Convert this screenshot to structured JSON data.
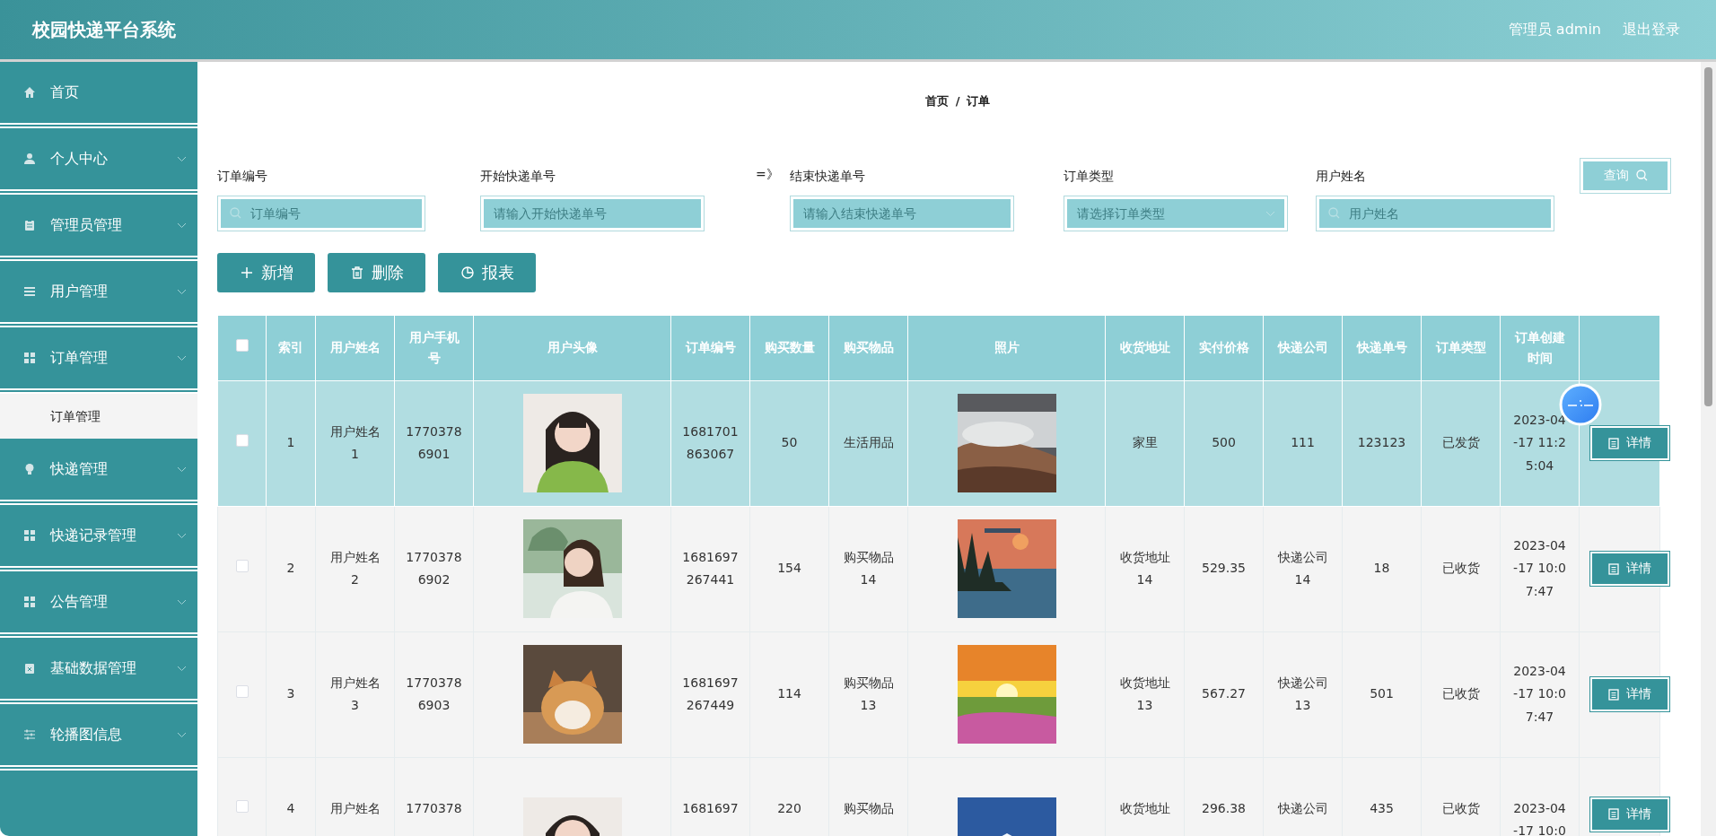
{
  "header": {
    "title": "校园快递平台系统",
    "user": "管理员 admin",
    "logout": "退出登录"
  },
  "sidebar": {
    "items": [
      {
        "label": "首页",
        "expandable": false
      },
      {
        "label": "个人中心",
        "expandable": true
      },
      {
        "label": "管理员管理",
        "expandable": true
      },
      {
        "label": "用户管理",
        "expandable": true
      },
      {
        "label": "订单管理",
        "expandable": true,
        "children": [
          {
            "label": "订单管理",
            "selected": true
          }
        ]
      },
      {
        "label": "快递管理",
        "expandable": true
      },
      {
        "label": "快递记录管理",
        "expandable": true
      },
      {
        "label": "公告管理",
        "expandable": true
      },
      {
        "label": "基础数据管理",
        "expandable": true
      },
      {
        "label": "轮播图信息",
        "expandable": true
      }
    ]
  },
  "breadcrumb": {
    "items": [
      "首页",
      "订单"
    ],
    "separator": "/"
  },
  "search": {
    "fields": [
      {
        "kind": "search",
        "label": "订单编号",
        "placeholder": "订单编号"
      },
      {
        "kind": "text",
        "label": "开始快递单号",
        "placeholder": "请输入开始快递单号"
      },
      {
        "kind": "text",
        "label": "结束快递单号",
        "placeholder": "请输入结束快递单号",
        "prefix": "=》"
      },
      {
        "kind": "select",
        "label": "订单类型",
        "placeholder": "请选择订单类型"
      },
      {
        "kind": "search",
        "label": "用户姓名",
        "placeholder": "用户姓名"
      }
    ],
    "button": "查询"
  },
  "actions": [
    "新增",
    "删除",
    "报表"
  ],
  "table": {
    "select_all": {
      "checked": false
    },
    "columns": [
      "索引",
      "用户姓名",
      "用户手机号",
      "用户头像",
      "订单编号",
      "购买数量",
      "购买物品",
      "照片",
      "收货地址",
      "实付价格",
      "快递公司",
      "快递单号",
      "订单类型",
      "订单创建时间"
    ],
    "rows": [
      {
        "selected": true,
        "checked": false,
        "cut": false,
        "cells": [
          "1",
          "用户姓名1",
          "17703786901",
          {
            "kind": "picture"
          },
          "1681701863067",
          "50",
          "生活用品",
          {
            "kind": "picture"
          },
          "家里",
          "500",
          "111",
          "123123",
          "已发货",
          "2023-04-17 11:25:04"
        ],
        "action": "详情"
      },
      {
        "selected": false,
        "checked": false,
        "cut": false,
        "cells": [
          "2",
          "用户姓名2",
          "17703786902",
          {
            "kind": "picture"
          },
          "1681697267441",
          "154",
          "购买物品14",
          {
            "kind": "picture"
          },
          "收货地址14",
          "529.35",
          "快递公司14",
          "18",
          "已收货",
          "2023-04-17 10:07:47"
        ],
        "action": "详情"
      },
      {
        "selected": false,
        "checked": false,
        "cut": false,
        "cells": [
          "3",
          "用户姓名3",
          "17703786903",
          {
            "kind": "picture"
          },
          "1681697267449",
          "114",
          "购买物品13",
          {
            "kind": "picture"
          },
          "收货地址13",
          "567.27",
          "快递公司13",
          "501",
          "已收货",
          "2023-04-17 10:07:47"
        ],
        "action": "详情"
      },
      {
        "selected": false,
        "checked": false,
        "cut": true,
        "cells": [
          "4",
          "用户姓名",
          "1770378",
          {
            "kind": "picture"
          },
          "1681697",
          "220",
          "购买物品",
          {
            "kind": "picture"
          },
          "收货地址",
          "296.38",
          "快递公司",
          "435",
          "已收货",
          "2023-04-17 10:0"
        ],
        "action": "详情"
      }
    ]
  }
}
